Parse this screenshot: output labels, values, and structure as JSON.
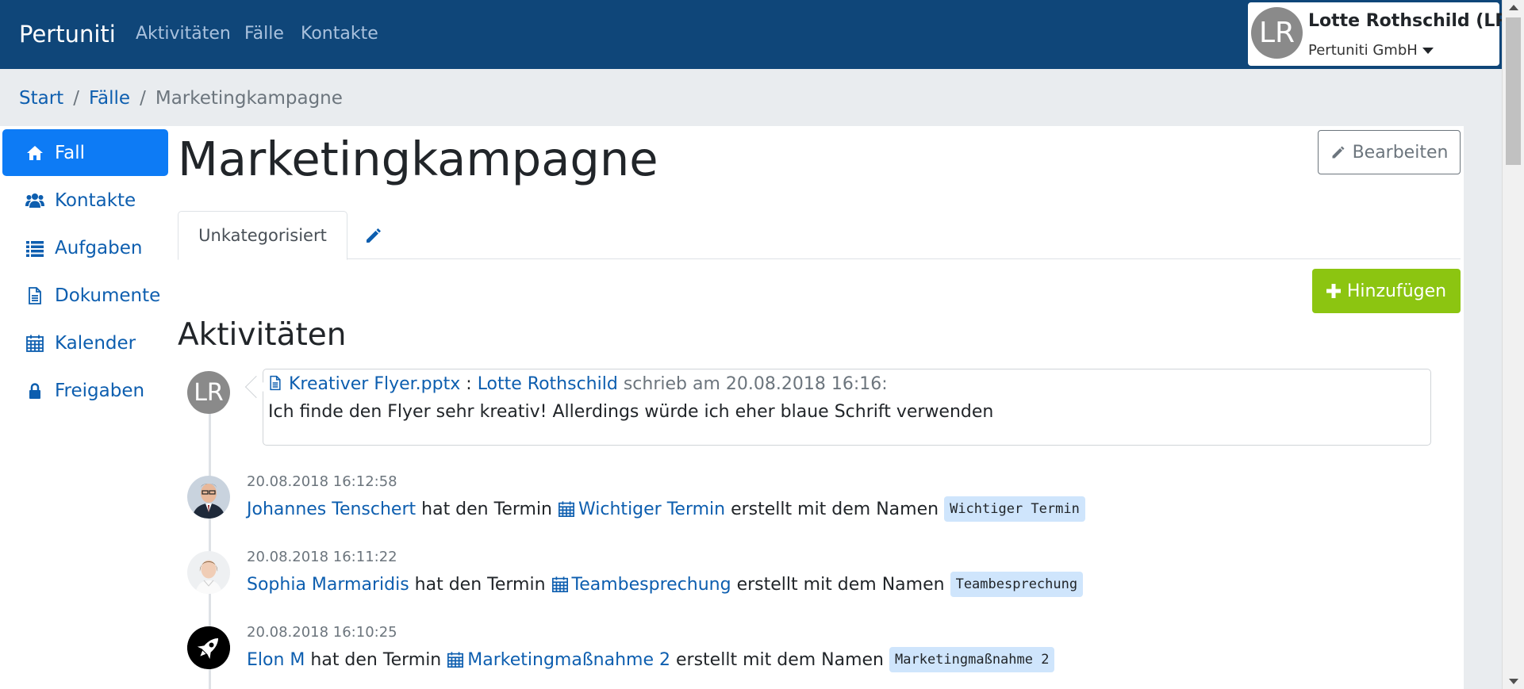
{
  "navbar": {
    "brand": "Pertuniti",
    "links": [
      "Aktivitäten",
      "Fälle",
      "Kontakte"
    ],
    "user": {
      "initials": "LR",
      "name": "Lotte Rothschild (LR)",
      "company": "Pertuniti GmbH"
    }
  },
  "breadcrumb": {
    "items": [
      "Start",
      "Fälle"
    ],
    "current": "Marketingkampagne"
  },
  "sidebar": {
    "items": [
      {
        "label": "Fall",
        "icon": "home-icon",
        "active": true
      },
      {
        "label": "Kontakte",
        "icon": "users-icon"
      },
      {
        "label": "Aufgaben",
        "icon": "list-icon"
      },
      {
        "label": "Dokumente",
        "icon": "file-icon"
      },
      {
        "label": "Kalender",
        "icon": "calendar-icon"
      },
      {
        "label": "Freigaben",
        "icon": "lock-icon"
      }
    ]
  },
  "page": {
    "title": "Marketingkampagne",
    "edit_label": "Bearbeiten",
    "tab_label": "Unkategorisiert",
    "add_label": "Hinzufügen",
    "section_title": "Aktivitäten"
  },
  "timeline": {
    "comment": {
      "initials": "LR",
      "file": "Kreativer Flyer.pptx",
      "sep": ":",
      "author": "Lotte Rothschild",
      "meta": "schrieb am 20.08.2018 16:16:",
      "text": "Ich finde den Flyer sehr kreativ! Allerdings würde ich eher blaue Schrift verwenden"
    },
    "events": [
      {
        "time": "20.08.2018 16:12:58",
        "user": "Johannes Tenschert",
        "verb": "hat den Termin",
        "item": "Wichtiger Termin",
        "suffix": "erstellt mit dem Namen",
        "code": "Wichtiger Termin"
      },
      {
        "time": "20.08.2018 16:11:22",
        "user": "Sophia Marmaridis",
        "verb": "hat den Termin",
        "item": "Teambesprechung",
        "suffix": "erstellt mit dem Namen",
        "code": "Teambesprechung"
      },
      {
        "time": "20.08.2018 16:10:25",
        "user": "Elon M",
        "verb": "hat den Termin",
        "item": "Marketingmaßnahme 2",
        "suffix": "erstellt mit dem Namen",
        "code": "Marketingmaßnahme 2"
      }
    ]
  },
  "colors": {
    "navbar": "#0f4679",
    "active": "#0d7bf5",
    "link": "#0d5eaf",
    "add_button": "#8cc511",
    "code_bg": "#cfe5fc"
  }
}
